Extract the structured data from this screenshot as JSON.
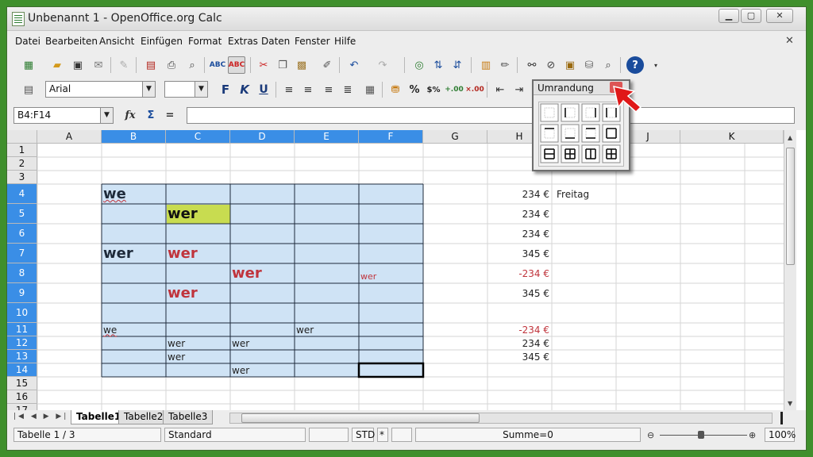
{
  "window": {
    "title": "Unbenannt 1 - OpenOffice.org Calc"
  },
  "menu": [
    "Datei",
    "Bearbeiten",
    "Ansicht",
    "Einfügen",
    "Format",
    "Extras",
    "Daten",
    "Fenster",
    "Hilfe"
  ],
  "format_toolbar": {
    "font_name": "Arial",
    "font_size": ""
  },
  "formula_bar": {
    "name_box": "B4:F14",
    "formula": ""
  },
  "popup": {
    "title": "Umrandung"
  },
  "columns": [
    "A",
    "B",
    "C",
    "D",
    "E",
    "F",
    "G",
    "H",
    "I",
    "J",
    "K"
  ],
  "rows": [
    "1",
    "2",
    "3",
    "4",
    "5",
    "6",
    "7",
    "8",
    "9",
    "10",
    "11",
    "12",
    "13",
    "14",
    "15",
    "16",
    "17"
  ],
  "cells": {
    "B4": "we",
    "C5": "wer",
    "B7": "wer",
    "C7": "wer",
    "D8": "wer",
    "F8": "wer",
    "C9": "wer",
    "B11": "we",
    "E11": "wer",
    "C12": "wer",
    "D12": "wer",
    "C13": "wer",
    "D14": "wer",
    "H4": "234 €",
    "H5": "234 €",
    "H6": "234 €",
    "H7": "345 €",
    "H8": "-234 €",
    "H9": "345 €",
    "H11": "-234 €",
    "H12": "234 €",
    "H13": "345 €",
    "I4": "Freitag"
  },
  "sheet_tabs": [
    "Tabelle1",
    "Tabelle2",
    "Tabelle3"
  ],
  "status": {
    "sheet": "Tabelle 1 / 3",
    "style": "Standard",
    "mode": "STD",
    "star": "*",
    "sum": "Summe=0",
    "zoom": "100%"
  },
  "colors": {
    "selection": "#cfe3f5",
    "header_selected": "#3a8ee6",
    "highlight_cell": "#c8dc50",
    "red_text": "#c0343c",
    "window_bg": "#3f8f2c"
  }
}
